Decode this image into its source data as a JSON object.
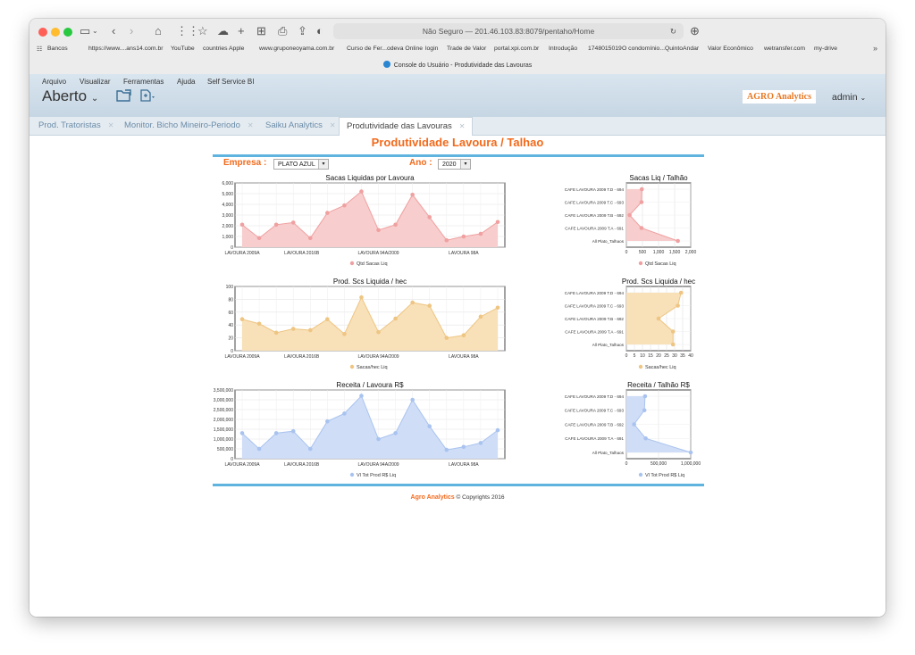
{
  "browser": {
    "url": "Não Seguro — 201.46.103.83:8079/pentaho/Home",
    "tab_title": "Console do Usuário - Produtividade das Lavouras",
    "bookmarks": [
      "Bancos",
      "https://www....ans14.com.br",
      "YouTube",
      "countries",
      "Apple",
      "www.gruponeoyama.com.br",
      "Curso de Fer...odeva Online",
      "login",
      "Trade de Valor",
      "portal.xpi.com.br",
      "Introdução",
      "1748015019",
      "O condomínio...QuintoAndar",
      "Valor Econômico",
      "wetransfer.com",
      "my-drive"
    ]
  },
  "app": {
    "menu": [
      "Arquivo",
      "Visualizar",
      "Ferramentas",
      "Ajuda",
      "Self Service BI"
    ],
    "perspective": "Aberto",
    "logo": "AGRO Analytics",
    "user": "admin",
    "tabs": [
      {
        "label": "Prod. Tratoristas",
        "active": false
      },
      {
        "label": "Monitor. Bicho Mineiro-Periodo",
        "active": false
      },
      {
        "label": "Saiku Analytics",
        "active": false
      },
      {
        "label": "Produtividade das Lavouras",
        "active": true
      }
    ]
  },
  "dashboard": {
    "title": "Produtividade Lavoura / Talhao",
    "empresa_label": "Empresa :",
    "empresa_value": "PLATO AZUL",
    "ano_label": "Ano :",
    "ano_value": "2020",
    "footer_brand": "Agro Analytics",
    "footer_copy": "© Copyrights 2016"
  },
  "chart_data": [
    {
      "id": "c1",
      "type": "area",
      "orientation": "vertical",
      "title": "Sacas Liquidas por Lavoura",
      "legend": "Qtd Sacas Liq",
      "legend_position": "bottom",
      "grid": true,
      "color": "#f0a0a0",
      "fill": "#f7cdcd",
      "x_labels": [
        "LAVOURA 2009A",
        "LAVOURA 2016B",
        "LAVOURA 94A/2009",
        "LAVOURA 98A"
      ],
      "values": [
        2100,
        850,
        2100,
        2300,
        850,
        3200,
        3900,
        5200,
        1600,
        2100,
        4900,
        2800,
        650,
        1000,
        1250,
        2350
      ],
      "ylim": [
        0,
        6000
      ],
      "ticks": [
        "0",
        "1,000",
        "2,000",
        "3,000",
        "4,000",
        "5,000",
        "6,000"
      ]
    },
    {
      "id": "c2",
      "type": "area",
      "orientation": "vertical",
      "title": "Prod. Scs Liquida / hec",
      "legend": "Sacas/hec Liq",
      "legend_position": "bottom",
      "grid": true,
      "color": "#eec582",
      "fill": "#f8e0b8",
      "x_labels": [
        "LAVOURA 2009A",
        "LAVOURA 2016B",
        "LAVOURA 94A/2009",
        "LAVOURA 98A"
      ],
      "values": [
        49,
        42,
        28,
        34,
        32,
        49,
        26,
        83,
        29,
        50,
        75,
        70,
        20,
        24,
        53,
        67
      ],
      "ylim": [
        0,
        100
      ],
      "ticks": [
        "0",
        "20",
        "40",
        "60",
        "80",
        "100"
      ]
    },
    {
      "id": "c3",
      "type": "area",
      "orientation": "vertical",
      "title": "Receita / Lavoura R$",
      "legend": "Vl Tot Prod R$ Liq",
      "legend_position": "bottom",
      "grid": true,
      "color": "#a9c3ef",
      "fill": "#cfddf7",
      "x_labels": [
        "LAVOURA 2009A",
        "LAVOURA 2016B",
        "LAVOURA 94A/2009",
        "LAVOURA 98A"
      ],
      "values": [
        1300000,
        500000,
        1300000,
        1400000,
        500000,
        1900000,
        2300000,
        3200000,
        1000000,
        1300000,
        3000000,
        1650000,
        450000,
        600000,
        800000,
        1450000
      ],
      "ylim": [
        0,
        3500000
      ],
      "ticks": [
        "0",
        "500,000",
        "1,000,000",
        "1,500,000",
        "2,000,000",
        "2,500,000",
        "3,000,000",
        "3,500,000"
      ]
    },
    {
      "id": "c4",
      "type": "area",
      "orientation": "horizontal",
      "title": "Sacas Liq / Talhão",
      "legend": "Qtd Sacas Liq",
      "legend_position": "bottom",
      "grid": true,
      "color": "#f0a0a0",
      "fill": "#f7cdcd",
      "categories": [
        "CAFE LAVOURA 2009 T.D - 694",
        "CAFE LAVOURA 2009 T.C - 693",
        "CAFE LAVOURA 2009 T.B - 692",
        "CAFE LAVOURA 2009 T.A - 691",
        "All Plato_Talhaos"
      ],
      "values": [
        480,
        470,
        100,
        470,
        1600
      ],
      "xlim": [
        0,
        2000
      ],
      "ticks": [
        "0",
        "500",
        "1,000",
        "1,500",
        "2,000"
      ]
    },
    {
      "id": "c5",
      "type": "area",
      "orientation": "horizontal",
      "title": "Prod. Scs Liquida / hec",
      "legend": "Sacas/hec Liq",
      "legend_position": "bottom",
      "grid": true,
      "color": "#eec582",
      "fill": "#f8e0b8",
      "categories": [
        "CAFE LAVOURA 2009 T.D - 694",
        "CAFE LAVOURA 2009 T.C - 693",
        "CAFE LAVOURA 2009 T.B - 692",
        "CAFE LAVOURA 2009 T.A - 691",
        "All Plato_Talhaos"
      ],
      "values": [
        34,
        32,
        20,
        29,
        29
      ],
      "xlim": [
        0,
        40
      ],
      "ticks": [
        "0",
        "5",
        "10",
        "15",
        "20",
        "25",
        "30",
        "35",
        "40"
      ]
    },
    {
      "id": "c6",
      "type": "area",
      "orientation": "horizontal",
      "title": "Receita / Talhão R$",
      "legend": "Vl Tot Prod R$ Liq",
      "legend_position": "bottom",
      "grid": true,
      "color": "#a9c3ef",
      "fill": "#cfddf7",
      "categories": [
        "CAFE LAVOURA 2009 T.D - 694",
        "CAFE LAVOURA 2009 T.C - 693",
        "CAFE LAVOURA 2009 T.B - 692",
        "CAFE LAVOURA 2009 T.A - 691",
        "All Plato_Talhaos"
      ],
      "values": [
        290000,
        280000,
        120000,
        300000,
        1000000
      ],
      "xlim": [
        0,
        1000000
      ],
      "ticks": [
        "0",
        "500,000",
        "1,000,000"
      ]
    }
  ]
}
